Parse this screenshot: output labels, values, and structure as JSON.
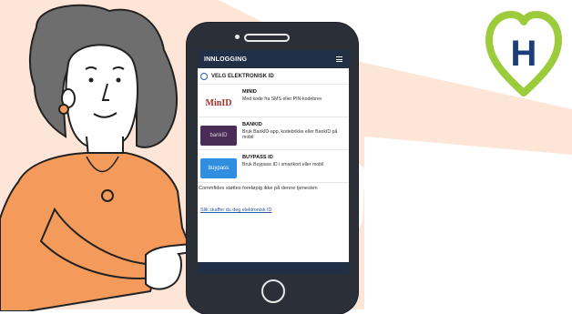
{
  "screen": {
    "header_title": "INNLOGGING",
    "section_title": "VELG ELEKTRONISK ID",
    "options": [
      {
        "logo_text": "MinID",
        "name": "MINID",
        "description": "Med kode fra SMS eller PIN-kodebrev"
      },
      {
        "logo_text": "bankID",
        "name": "BANKID",
        "description": "Bruk BankID-app, kodebrikke eller BankID på mobil"
      },
      {
        "logo_text": "buypass",
        "name": "BUYPASS ID",
        "description": "Bruk Buypass ID i smartkort eller mobil"
      }
    ],
    "commfides_note": "Commfides støttes foreløpig ikke på denne tjenesten",
    "help_link": "Slik skaffer du deg elektronisk ID"
  },
  "brand": {
    "logo_letter": "H"
  },
  "colors": {
    "background_band": "#fde6d8",
    "sweater": "#f49a5a",
    "hair": "#6e6e6e",
    "phone_body": "#2b2f38",
    "header_bar": "#223047",
    "brand_green": "#9ccb3b",
    "brand_blue": "#1d3c7a"
  }
}
